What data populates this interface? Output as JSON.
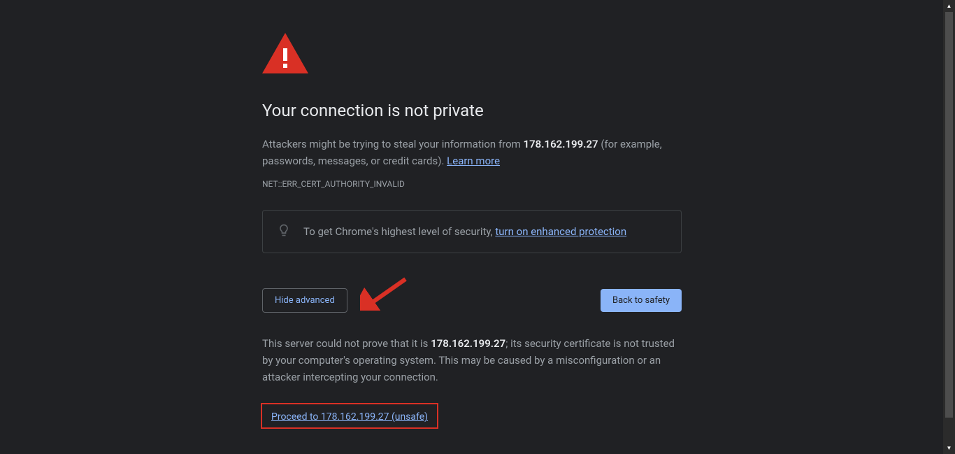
{
  "icons": {
    "warning": "warning-triangle-icon",
    "bulb": "lightbulb-icon"
  },
  "title": "Your connection is not private",
  "description": {
    "prefix": "Attackers might be trying to steal your information from ",
    "host": "178.162.199.27",
    "suffix": " (for example, passwords, messages, or credit cards). ",
    "learn_more": "Learn more"
  },
  "error_code": "NET::ERR_CERT_AUTHORITY_INVALID",
  "protection": {
    "prefix": "To get Chrome's highest level of security, ",
    "link": "turn on enhanced protection"
  },
  "buttons": {
    "hide_advanced": "Hide advanced",
    "back_to_safety": "Back to safety"
  },
  "advanced": {
    "text_prefix": "This server could not prove that it is ",
    "host": "178.162.199.27",
    "text_suffix": "; its security certificate is not trusted by your computer's operating system. This may be caused by a misconfiguration or an attacker intercepting your connection."
  },
  "proceed_link": "Proceed to 178.162.199.27 (unsafe)"
}
